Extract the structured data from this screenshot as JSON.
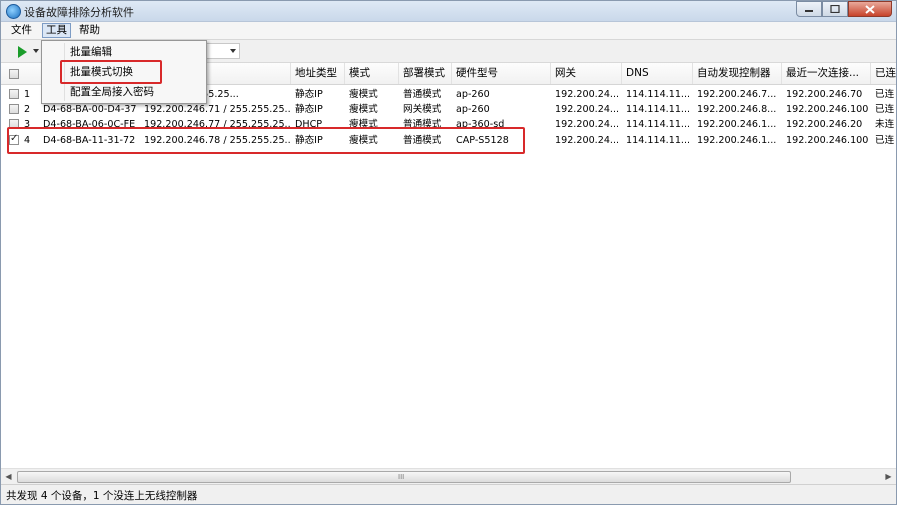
{
  "window": {
    "title": "设备故障排除分析软件"
  },
  "menu": {
    "file": "文件",
    "tools": "工具",
    "help": "帮助"
  },
  "dropdown": {
    "items": [
      "批量编辑",
      "批量模式切换",
      "配置全局接入密码"
    ],
    "highlighted_index": 1
  },
  "table": {
    "headers": {
      "ip": "",
      "addr_type": "地址类型",
      "mode": "模式",
      "deploy": "部署模式",
      "hw": "硬件型号",
      "gateway": "网关",
      "dns": "DNS",
      "controller": "自动发现控制器",
      "last_conn": "最近一次连接...",
      "status": "已连"
    },
    "rows": [
      {
        "checked": false,
        "num": "1",
        "mac": "",
        "ip": "...76 / 255.255.25...",
        "addr_type": "静态IP",
        "mode": "瘦模式",
        "deploy": "普通模式",
        "hw": "ap-260",
        "gateway": "192.200.24...",
        "dns": "114.114.11...",
        "controller": "192.200.246.7...",
        "last_conn": "192.200.246.70",
        "status": "已连"
      },
      {
        "checked": false,
        "num": "2",
        "mac": "D4-68-BA-00-D4-37",
        "ip": "192.200.246.71 / 255.255.25...",
        "addr_type": "静态IP",
        "mode": "瘦模式",
        "deploy": "网关模式",
        "hw": "ap-260",
        "gateway": "192.200.24...",
        "dns": "114.114.11...",
        "controller": "192.200.246.8...",
        "last_conn": "192.200.246.100",
        "status": "已连"
      },
      {
        "checked": false,
        "num": "3",
        "mac": "D4-68-BA-06-0C-FE",
        "ip": "192.200.246.77 / 255.255.25...",
        "addr_type": "DHCP",
        "mode": "瘦模式",
        "deploy": "普通模式",
        "hw": "ap-360-sd",
        "gateway": "192.200.24...",
        "dns": "114.114.11...",
        "controller": "192.200.246.1...",
        "last_conn": "192.200.246.20",
        "status": "未连"
      },
      {
        "checked": true,
        "num": "4",
        "mac": "D4-68-BA-11-31-72",
        "ip": "192.200.246.78 / 255.255.25...",
        "addr_type": "静态IP",
        "mode": "瘦模式",
        "deploy": "普通模式",
        "hw": "CAP-S5128",
        "gateway": "192.200.24...",
        "dns": "114.114.11...",
        "controller": "192.200.246.1...",
        "last_conn": "192.200.246.100",
        "status": "已连"
      }
    ]
  },
  "scrollbar": {
    "grip": "III",
    "left_arrow": "◀",
    "right_arrow": "▶"
  },
  "status": {
    "text": "共发现 4 个设备，1 个没连上无线控制器"
  },
  "colors": {
    "highlight_red": "#d8292a",
    "play_green": "#1a9c2a"
  },
  "icons": {
    "app": "app-icon",
    "play": "play-icon",
    "minimize": "minimize-icon",
    "maximize": "maximize-icon",
    "close": "close-icon"
  }
}
